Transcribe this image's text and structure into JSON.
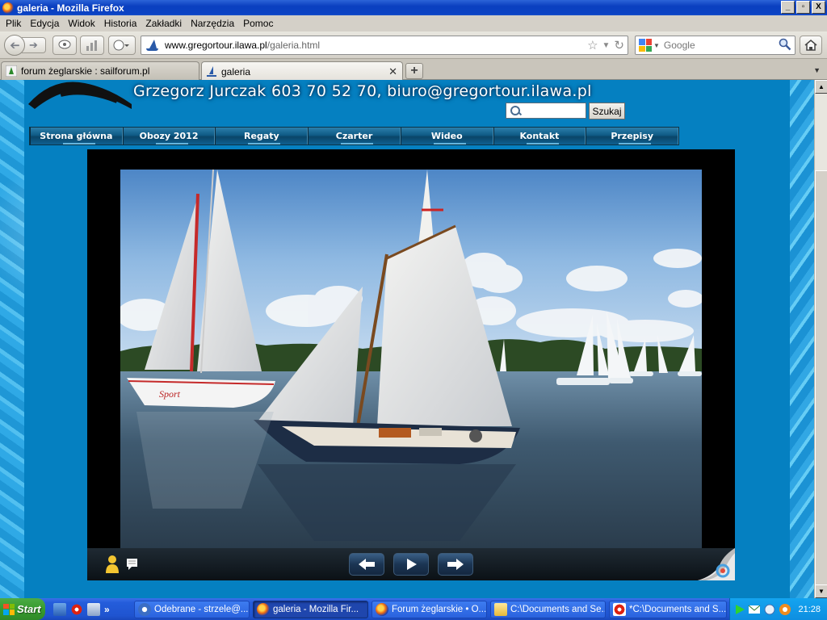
{
  "window": {
    "title": "galeria - Mozilla Firefox",
    "controls": [
      "_",
      "▫",
      "X"
    ]
  },
  "menu": [
    "Plik",
    "Edycja",
    "Widok",
    "Historia",
    "Zakładki",
    "Narzędzia",
    "Pomoc"
  ],
  "toolbar": {
    "url_host": "www.gregortour.ilawa.pl",
    "url_path": "/galeria.html",
    "search_placeholder": "Google"
  },
  "tabs": [
    {
      "label": "forum żeglarskie : sailforum.pl",
      "active": false
    },
    {
      "label": "galeria",
      "active": true
    }
  ],
  "site": {
    "contact": "Grzegorz Jurczak 603 70 52 70, biuro@gregortour.ilawa.pl",
    "search_button": "Szukaj",
    "nav": [
      "Strona główna",
      "Obozy 2012",
      "Regaty",
      "Czarter",
      "Wideo",
      "Kontakt",
      "Przepisy"
    ]
  },
  "gallery": {
    "photo_subject": "Sailboats on a lake",
    "boat_name": "Sport"
  },
  "taskbar": {
    "start_label": "Start",
    "more": "»",
    "tasks": [
      {
        "label": "Odebrane - strzele@...",
        "active": false
      },
      {
        "label": "galeria - Mozilla Fir...",
        "active": true
      },
      {
        "label": "Forum żeglarskie • O...",
        "active": false
      },
      {
        "label": "C:\\Documents and Se...",
        "active": false
      },
      {
        "label": "*C:\\Documents and S...",
        "active": false
      }
    ],
    "clock": "21:28"
  },
  "colors": {
    "site_panel": "#0580c1",
    "title_bar": "#0a3fbf",
    "taskbar": "#245ddb",
    "start": "#379b2f"
  }
}
